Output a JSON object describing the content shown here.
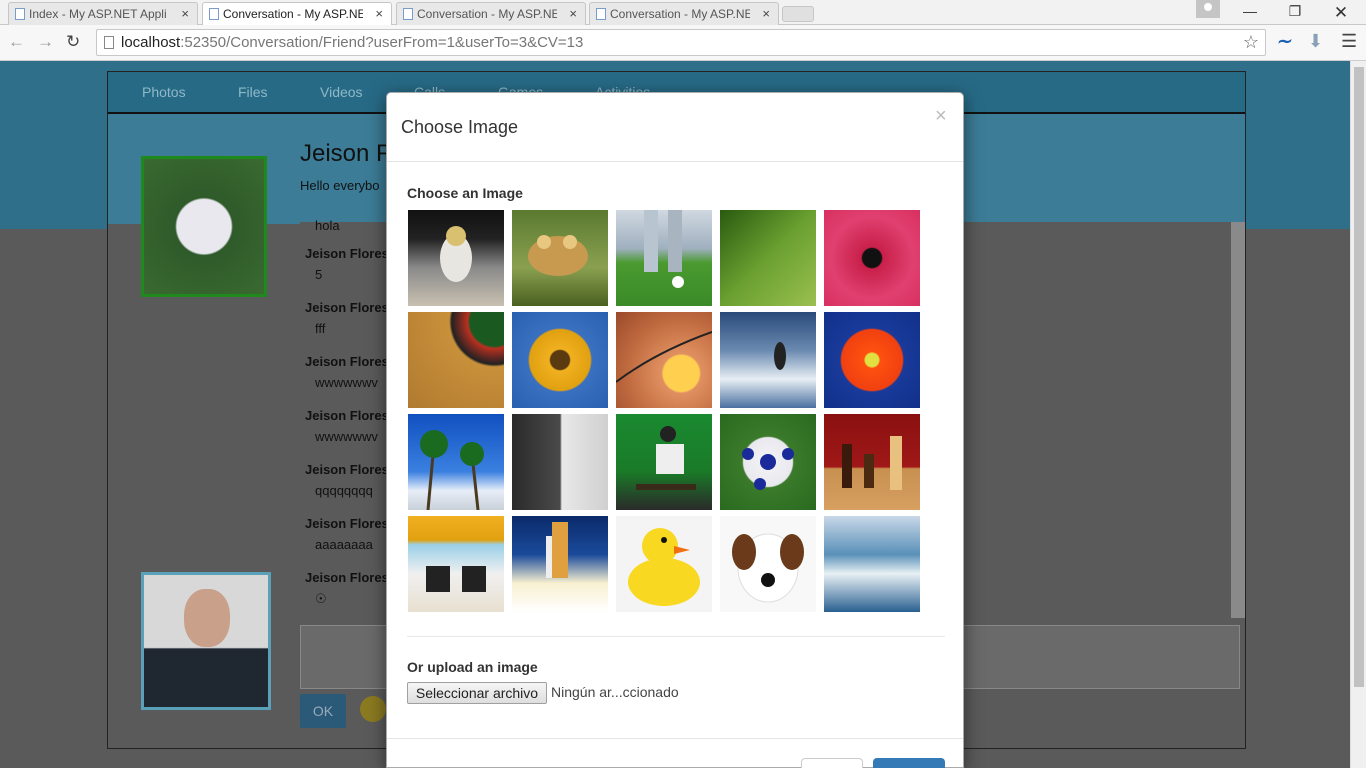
{
  "browser": {
    "tabs": [
      {
        "label": "Index - My ASP.NET Appli"
      },
      {
        "label": "Conversation - My ASP.NE"
      },
      {
        "label": "Conversation - My ASP.NE"
      },
      {
        "label": "Conversation - My ASP.NE"
      }
    ],
    "close_glyph": "×",
    "url_host": "localhost",
    "url_rest": ":52350/Conversation/Friend?userFrom=1&userTo=3&CV=13"
  },
  "app": {
    "nav": [
      "Photos",
      "Files",
      "Videos",
      "Calls",
      "Games",
      "Activities"
    ],
    "profile_name": "Jeison F",
    "status": "Hello everybo",
    "messages": [
      {
        "author": "",
        "text": "hola"
      },
      {
        "author": "Jeison Flores",
        "text": "5"
      },
      {
        "author": "Jeison Flores",
        "text": "fff"
      },
      {
        "author": "Jeison Flores",
        "text": "wwwwwwv"
      },
      {
        "author": "Jeison Flores",
        "text": "wwwwwwv"
      },
      {
        "author": "Jeison Flores",
        "text": "qqqqqqqq"
      },
      {
        "author": "Jeison Flores",
        "text": "aaaaaaaa"
      },
      {
        "author": "Jeison Flores",
        "text": ""
      }
    ],
    "ok_label": "OK"
  },
  "modal": {
    "title": "Choose Image",
    "close": "×",
    "choose_heading": "Choose an Image",
    "upload_heading": "Or upload an image",
    "file_button": "Seleccionar archivo",
    "file_status": "Ningún ar...ccionado",
    "images": [
      "astronaut",
      "frog",
      "golf",
      "leaf",
      "pink-flower",
      "roulette",
      "sunflower",
      "sunset-grass",
      "surfer",
      "orange-flower",
      "palm-trees",
      "horses",
      "skateboarder",
      "soccer-ball",
      "chess",
      "beach-chairs",
      "space-shuttle",
      "rubber-duck",
      "puppy",
      "wave"
    ]
  }
}
